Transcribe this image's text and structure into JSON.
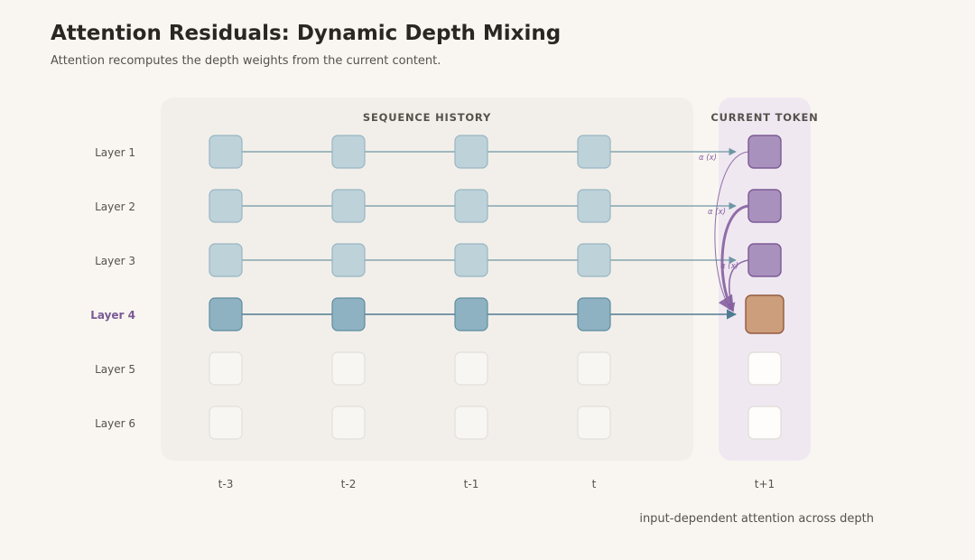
{
  "title": "Attention Residuals: Dynamic Depth Mixing",
  "subtitle": "Attention recomputes the depth weights from the current content.",
  "panels": {
    "history_label": "SEQUENCE HISTORY",
    "current_label": "CURRENT TOKEN"
  },
  "layers": [
    "Layer 1",
    "Layer 2",
    "Layer 3",
    "Layer 4",
    "Layer 5",
    "Layer 6"
  ],
  "history_columns": [
    "t-3",
    "t-2",
    "t-1",
    "t"
  ],
  "current_column": "t+1",
  "active_layer_index": 3,
  "attention_label": "α (x)",
  "caption": "input-dependent attention across depth",
  "colors": {
    "background": "#f9f6f1",
    "history_panel": "#f2efea",
    "current_panel": "#efe8f1",
    "computed_block": "#bed2da",
    "computed_block_border": "#98b6c2",
    "active_block": "#8eb2c1",
    "active_block_border": "#5d8da0",
    "empty_block": "#f8f6f3",
    "empty_block_border": "#e3dfdb",
    "current_block": "#a991bd",
    "current_block_border": "#7c5a95",
    "target_block": "#cc9e7c",
    "target_block_border": "#935a3e",
    "arrow": "#6e96a5",
    "arrow_active": "#4f7b90",
    "attention": "#8660a0",
    "active_layer_text": "#7a5a94"
  }
}
